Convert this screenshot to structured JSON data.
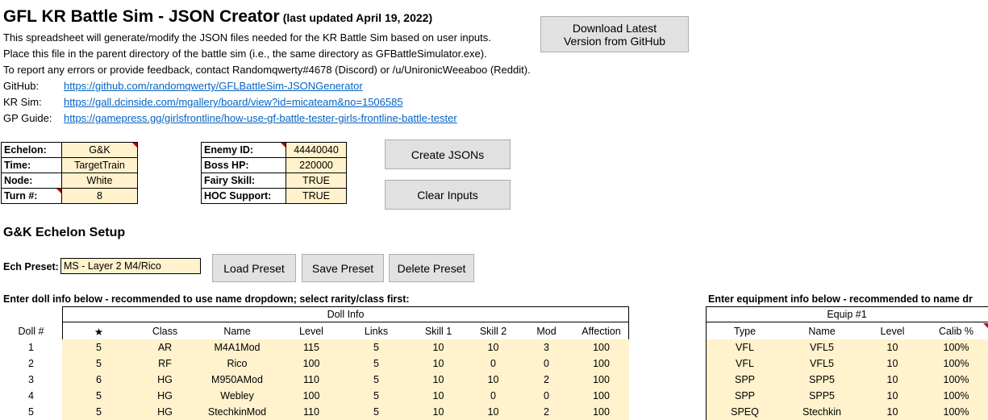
{
  "header": {
    "title": "GFL KR Battle Sim - JSON Creator",
    "updated": "(last updated April 19, 2022)",
    "lines": [
      "This spreadsheet will generate/modify the JSON files needed for the KR Battle Sim based on user inputs.",
      "Place this file in the parent directory of the battle sim (i.e., the same directory as GFBattleSimulator.exe).",
      "To report any errors or provide feedback, contact Randomqwerty#4678 (Discord) or /u/UnironicWeeaboo (Reddit)."
    ],
    "links": [
      {
        "label": "GitHub:",
        "url": "https://github.com/randomqwerty/GFLBattleSim-JSONGenerator"
      },
      {
        "label": "KR Sim:",
        "url": "https://gall.dcinside.com/mgallery/board/view?id=micateam&no=1506585"
      },
      {
        "label": "GP Guide:",
        "url": "https://gamepress.gg/girlsfrontline/how-use-gf-battle-tester-girls-frontline-battle-tester"
      }
    ],
    "download_button": "Download Latest Version from GitHub"
  },
  "settings_left": [
    {
      "key": "Echelon:",
      "value": "G&K"
    },
    {
      "key": "Time:",
      "value": "TargetTrain"
    },
    {
      "key": "Node:",
      "value": "White"
    },
    {
      "key": "Turn #:",
      "value": "8"
    }
  ],
  "settings_right": [
    {
      "key": "Enemy ID:",
      "value": "44440040"
    },
    {
      "key": "Boss HP:",
      "value": "220000"
    },
    {
      "key": "Fairy Skill:",
      "value": "TRUE"
    },
    {
      "key": "HOC Support:",
      "value": "TRUE"
    }
  ],
  "actions": {
    "create": "Create JSONs",
    "clear": "Clear Inputs"
  },
  "echelon": {
    "section_title": "G&K Echelon Setup",
    "preset_label": "Ech Preset:",
    "preset_value": "MS - Layer 2 M4/Rico",
    "load": "Load Preset",
    "save": "Save Preset",
    "delete": "Delete Preset"
  },
  "doll_table": {
    "note": "Enter doll info below - recommended to use name dropdown; select rarity/class first:",
    "group": "Doll Info",
    "columns": [
      "Doll #",
      "★",
      "Class",
      "Name",
      "Level",
      "Links",
      "Skill 1",
      "Skill 2",
      "Mod",
      "Affection"
    ],
    "rows": [
      [
        "1",
        "5",
        "AR",
        "M4A1Mod",
        "115",
        "5",
        "10",
        "10",
        "3",
        "100"
      ],
      [
        "2",
        "5",
        "RF",
        "Rico",
        "100",
        "5",
        "10",
        "0",
        "0",
        "100"
      ],
      [
        "3",
        "6",
        "HG",
        "M950AMod",
        "110",
        "5",
        "10",
        "10",
        "2",
        "100"
      ],
      [
        "4",
        "5",
        "HG",
        "Webley",
        "100",
        "5",
        "10",
        "0",
        "0",
        "100"
      ],
      [
        "5",
        "5",
        "HG",
        "StechkinMod",
        "110",
        "5",
        "10",
        "10",
        "2",
        "100"
      ]
    ]
  },
  "equip_table": {
    "note": "Enter equipment info below - recommended to name dr",
    "group": "Equip #1",
    "columns": [
      "Type",
      "Name",
      "Level",
      "Calib %"
    ],
    "rows": [
      [
        "VFL",
        "VFL5",
        "10",
        "100%"
      ],
      [
        "VFL",
        "VFL5",
        "10",
        "100%"
      ],
      [
        "SPP",
        "SPP5",
        "10",
        "100%"
      ],
      [
        "SPP",
        "SPP5",
        "10",
        "100%"
      ],
      [
        "SPEQ",
        "Stechkin",
        "10",
        "100%"
      ]
    ]
  }
}
